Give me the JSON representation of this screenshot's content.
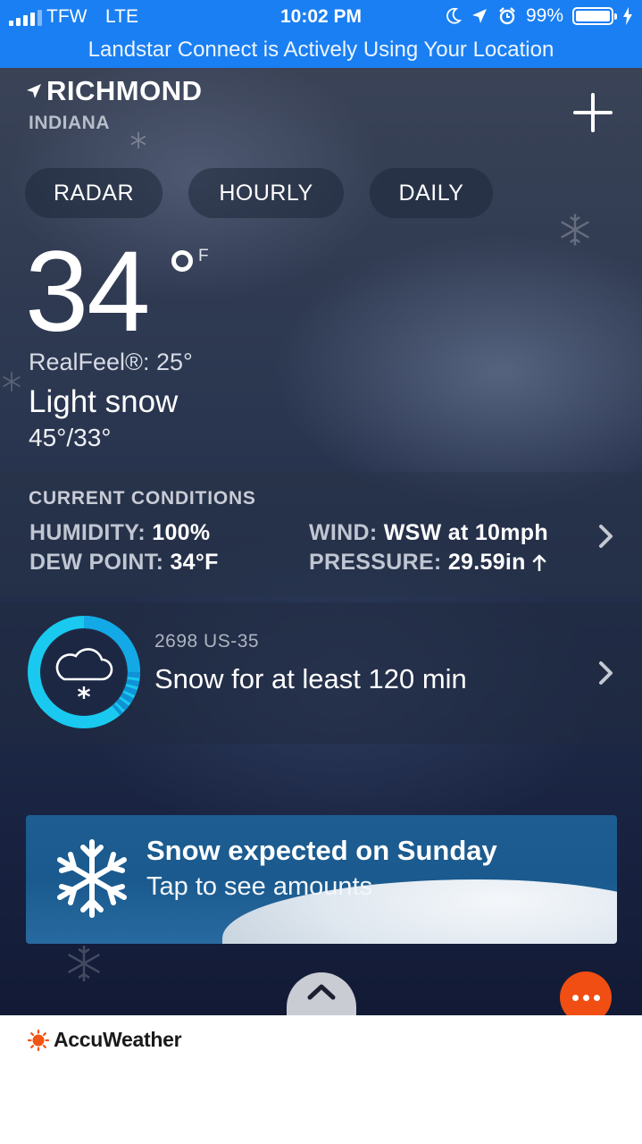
{
  "status_bar": {
    "carrier": "TFW",
    "network": "LTE",
    "time": "10:02 PM",
    "battery": "99%",
    "icons": [
      "signal-bars-icon",
      "moon-icon",
      "location-arrow-icon",
      "alarm-icon",
      "battery-icon",
      "charging-bolt-icon"
    ]
  },
  "location_banner": "Landstar Connect is Actively Using Your Location",
  "location": {
    "city": "RICHMOND",
    "state": "INDIANA"
  },
  "tabs": {
    "radar": "RADAR",
    "hourly": "HOURLY",
    "daily": "DAILY"
  },
  "current": {
    "temperature": "34",
    "unit": "F",
    "realfeel": "RealFeel®: 25°",
    "phrase": "Light snow",
    "hi_lo": "45°/33°"
  },
  "conditions": {
    "title": "CURRENT CONDITIONS",
    "humidity_label": "HUMIDITY:",
    "humidity_value": "100%",
    "dew_point_label": "DEW POINT:",
    "dew_point_value": "34°F",
    "wind_label": "WIND:",
    "wind_value": "WSW at 10mph",
    "pressure_label": "PRESSURE:",
    "pressure_value": "29.59in"
  },
  "minutecast": {
    "address": "2698 US-35",
    "text": "Snow for at least 120 min"
  },
  "promo": {
    "title": "Snow expected on Sunday",
    "subtitle": "Tap to see amounts"
  },
  "footer": {
    "brand": "AccuWeather"
  },
  "colors": {
    "status_blue": "#1a7ff2",
    "accent_cyan": "#1fd3f5",
    "menu_orange": "#f04e13",
    "brand_orange": "#f05514"
  }
}
